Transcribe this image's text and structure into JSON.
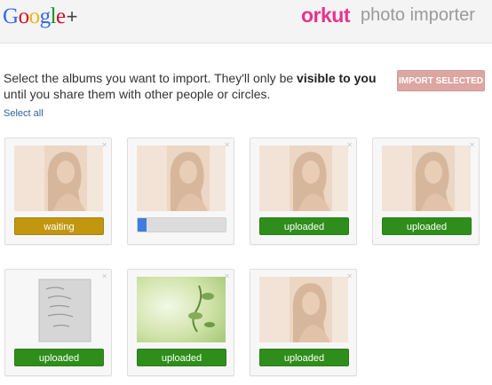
{
  "header": {
    "google_letters": [
      {
        "ch": "G",
        "color": "#3369e8"
      },
      {
        "ch": "o",
        "color": "#d50f25"
      },
      {
        "ch": "o",
        "color": "#eeb211"
      },
      {
        "ch": "g",
        "color": "#3369e8"
      },
      {
        "ch": "l",
        "color": "#009925"
      },
      {
        "ch": "e",
        "color": "#d50f25"
      }
    ],
    "google_plus": "+",
    "orkut": "orkut",
    "title": "photo importer"
  },
  "instructions": {
    "before": "Select the albums you want to import. They'll only be ",
    "bold": "visible to you",
    "after": " until you share them with other people or circles."
  },
  "import_button": "IMPORT SELECTED",
  "select_all": "Select all",
  "colors": {
    "waiting": "#c29710",
    "uploaded": "#2f8e1b",
    "progress": "#3d7ee0",
    "import_disabled": "#dca6a2",
    "orkut_brand": "#e8338d"
  },
  "albums": [
    {
      "thumb": "portrait",
      "status": "waiting",
      "label": "waiting"
    },
    {
      "thumb": "portrait",
      "status": "progress",
      "progress": 0.1
    },
    {
      "thumb": "portrait",
      "status": "uploaded",
      "label": "uploaded"
    },
    {
      "thumb": "portrait",
      "status": "uploaded",
      "label": "uploaded"
    },
    {
      "thumb": "card",
      "status": "uploaded",
      "label": "uploaded"
    },
    {
      "thumb": "nature",
      "status": "uploaded",
      "label": "uploaded"
    },
    {
      "thumb": "portrait",
      "status": "uploaded",
      "label": "uploaded"
    }
  ]
}
